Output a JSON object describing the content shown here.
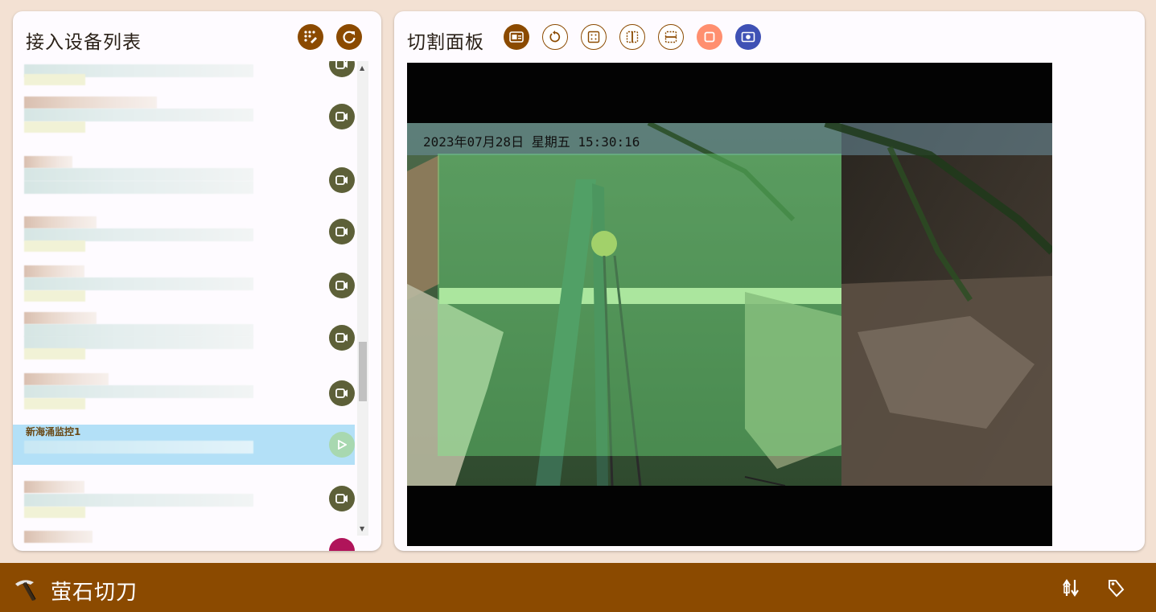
{
  "device_panel": {
    "title": "接入设备列表",
    "actions": [
      {
        "name": "dialpad-edit",
        "icon": "dialpad-edit-icon"
      },
      {
        "name": "refresh",
        "icon": "refresh-icon"
      }
    ],
    "selected_device_name": "新海涌监控1"
  },
  "cut_panel": {
    "title": "切割面板",
    "tools": [
      {
        "name": "video-label",
        "icon": "video-label-icon"
      },
      {
        "name": "rotate",
        "icon": "rotate-icon"
      },
      {
        "name": "grid-dots",
        "icon": "grid-dots-icon"
      },
      {
        "name": "split-vertical",
        "icon": "split-vertical-icon"
      },
      {
        "name": "split-horizontal",
        "icon": "split-horizontal-icon"
      },
      {
        "name": "crop-square",
        "icon": "crop-square-icon"
      },
      {
        "name": "capture",
        "icon": "capture-icon"
      }
    ],
    "video_timestamp": "2023年07月28日 星期五 15:30:16"
  },
  "app_bar": {
    "title": "萤石切刀",
    "actions": [
      {
        "name": "swap",
        "icon": "swap-icon"
      },
      {
        "name": "tag",
        "icon": "tag-icon"
      }
    ]
  },
  "colors": {
    "brand": "#8b4a00",
    "background": "#f3e1d3",
    "selected_row": "#b3e0f7",
    "camera_button": "#5d6038",
    "crop_accent": "#ff8f6f",
    "capture_accent": "#3f51b5"
  }
}
